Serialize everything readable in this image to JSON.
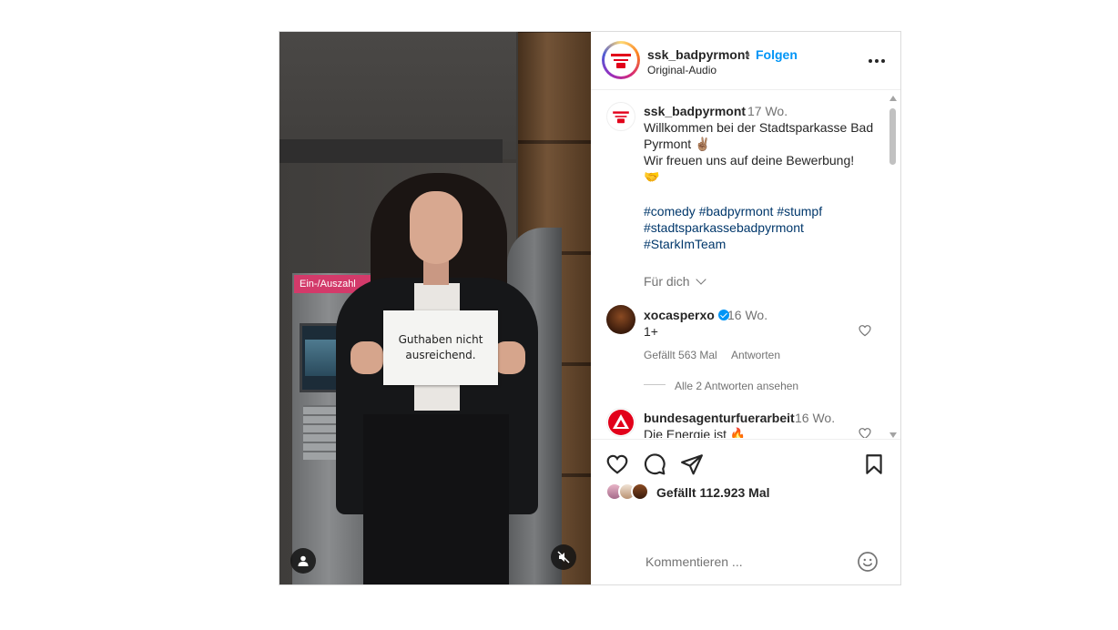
{
  "video": {
    "sign_line1": "Guthaben nicht",
    "sign_line2": "ausreichend.",
    "atm_sign": "Ein-/Auszahl"
  },
  "header": {
    "username": "ssk_badpyrmont",
    "separator": "•",
    "follow_label": "Folgen",
    "audio": "Original-Audio"
  },
  "caption": {
    "username": "ssk_badpyrmont",
    "time": "17 Wo.",
    "line1": "Willkommen bei der Stadtsparkasse Bad Pyrmont ✌🏽",
    "line2": "Wir freuen uns auf deine Bewerbung!",
    "line3": "🤝",
    "hashtag1": "#comedy",
    "hashtag2": "#badpyrmont",
    "hashtag3": "#stumpf",
    "hashtag4": "#stadtsparkassebadpyrmont",
    "hashtag5": "#StarkImTeam",
    "for_you": "Für dich"
  },
  "comments": [
    {
      "username": "xocasperxo",
      "verified": true,
      "time": "16 Wo.",
      "text": "1+",
      "likes": "Gefällt 563 Mal",
      "reply": "Antworten",
      "view_replies": "Alle 2 Antworten ansehen"
    },
    {
      "username": "bundesagenturfuerarbeit",
      "time": "16 Wo.",
      "text": "Die Energie ist 🔥"
    }
  ],
  "actions": {
    "likes_text": "Gefällt 112.923 Mal"
  },
  "comment_box": {
    "placeholder": "Kommentieren ..."
  },
  "colors": {
    "link_blue": "#0095f6",
    "hashtag": "#00376b",
    "brand_red": "#e2001a"
  }
}
